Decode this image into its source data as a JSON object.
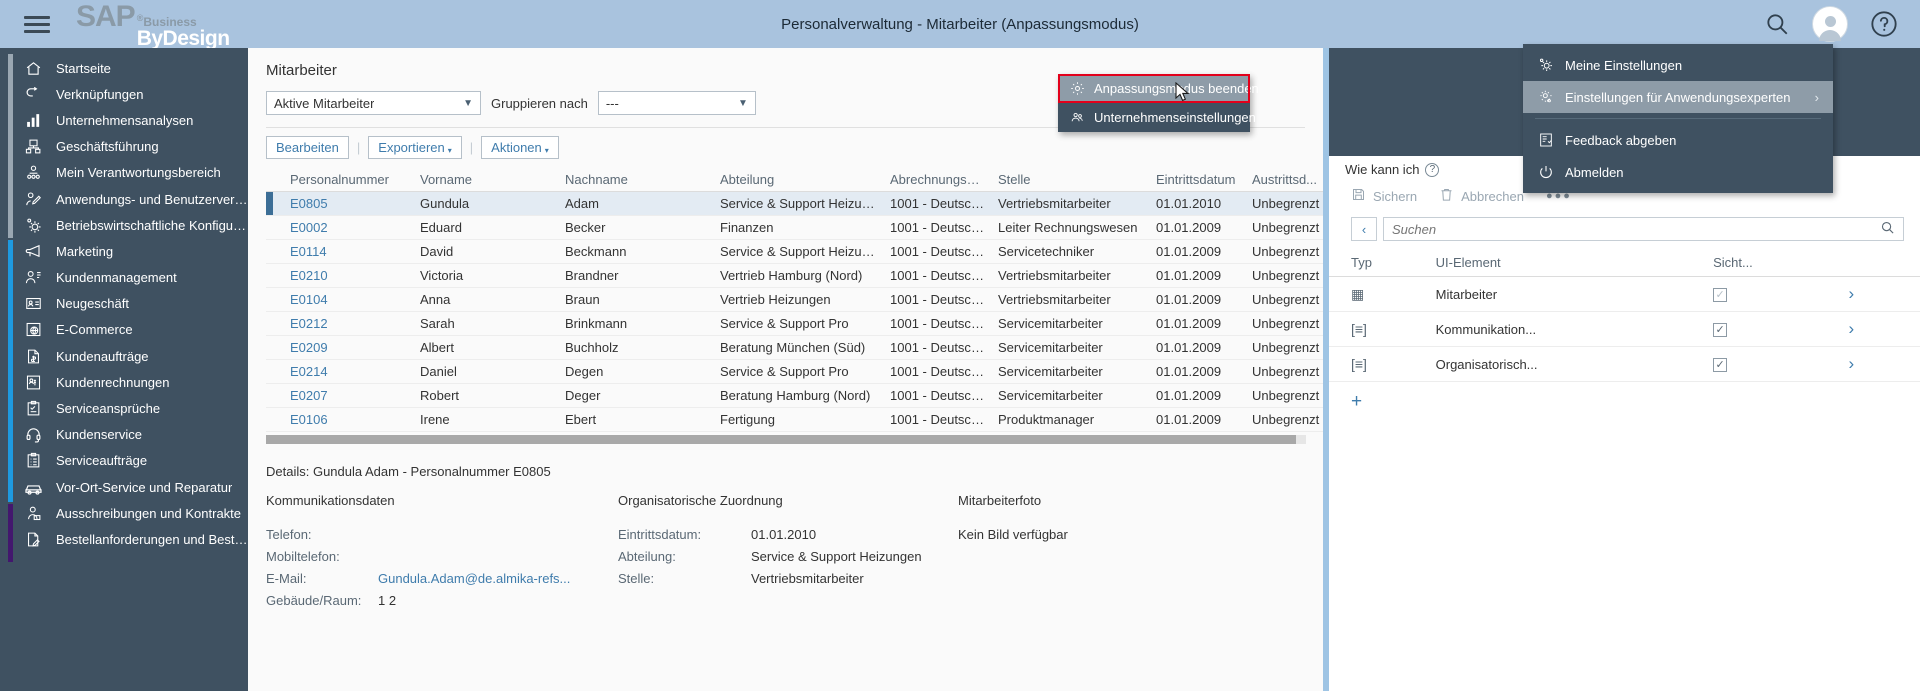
{
  "shell": {
    "brand_sap": "SAP",
    "brand_reg": "®",
    "brand_business": "Business",
    "brand_bydesign": "ByDesign",
    "title": "Personalverwaltung - Mitarbeiter (Anpassungsmodus)",
    "menu_icon": "hamburger-icon",
    "search_icon": "search-icon",
    "help_icon": "help-icon",
    "avatar_icon": "user-avatar-icon"
  },
  "sidebar": {
    "items": [
      {
        "label": "Startseite",
        "icon": "home-icon",
        "rail": "gray"
      },
      {
        "label": "Verknüpfungen",
        "icon": "link-icon",
        "rail": "gray"
      },
      {
        "label": "Unternehmensanalysen",
        "icon": "bar-chart-icon",
        "rail": "gray"
      },
      {
        "label": "Geschäftsführung",
        "icon": "org-chart-icon",
        "rail": "gray"
      },
      {
        "label": "Mein Verantwortungsbereich",
        "icon": "people-icon",
        "rail": "gray"
      },
      {
        "label": "Anwendungs- und Benutzerverw...",
        "icon": "user-edit-icon",
        "rail": "gray"
      },
      {
        "label": "Betriebswirtschaftliche Konfigurat...",
        "icon": "gear-config-icon",
        "rail": "gray"
      },
      {
        "label": "Marketing",
        "icon": "megaphone-icon",
        "rail": "blue"
      },
      {
        "label": "Kundenmanagement",
        "icon": "user-list-icon",
        "rail": "blue"
      },
      {
        "label": "Neugeschäft",
        "icon": "contact-card-icon",
        "rail": "blue"
      },
      {
        "label": "E-Commerce",
        "icon": "globe-shop-icon",
        "rail": "blue"
      },
      {
        "label": "Kundenaufträge",
        "icon": "invoice-dollar-icon",
        "rail": "blue"
      },
      {
        "label": "Kundenrechnungen",
        "icon": "billing-icon",
        "rail": "blue"
      },
      {
        "label": "Serviceansprüche",
        "icon": "clipboard-check-icon",
        "rail": "blue"
      },
      {
        "label": "Kundenservice",
        "icon": "headset-icon",
        "rail": "blue"
      },
      {
        "label": "Serviceaufträge",
        "icon": "clipboard-list-icon",
        "rail": "blue"
      },
      {
        "label": "Vor-Ort-Service und Reparatur",
        "icon": "car-service-icon",
        "rail": "blue"
      },
      {
        "label": "Ausschreibungen und Kontrakte",
        "icon": "person-contract-icon",
        "rail": "purple"
      },
      {
        "label": "Bestellanforderungen und Bestell...",
        "icon": "document-edit-icon",
        "rail": "purple"
      }
    ]
  },
  "main": {
    "page_title": "Mitarbeiter",
    "filter": {
      "view_value": "Aktive Mitarbeiter",
      "group_label": "Gruppieren nach",
      "group_value": "---"
    },
    "toolbar": {
      "edit": "Bearbeiten",
      "export": "Exportieren",
      "actions": "Aktionen"
    },
    "table": {
      "columns": [
        "Personalnummer",
        "Vorname",
        "Nachname",
        "Abteilung",
        "Abrechnungskreis",
        "Stelle",
        "Eintrittsdatum",
        "Austrittsd..."
      ],
      "rows": [
        {
          "pnr": "E0805",
          "vorname": "Gundula",
          "nachname": "Adam",
          "abteilung": "Service & Support Heizungen",
          "abrechnungskreis": "1001 - Deutschla...",
          "stelle": "Vertriebsmitarbeiter",
          "eintritt": "01.01.2010",
          "austritt": "Unbegrenzt",
          "selected": true
        },
        {
          "pnr": "E0002",
          "vorname": "Eduard",
          "nachname": "Becker",
          "abteilung": "Finanzen",
          "abrechnungskreis": "1001 - Deutschla...",
          "stelle": "Leiter Rechnungswesen",
          "eintritt": "01.01.2009",
          "austritt": "Unbegrenzt",
          "selected": false
        },
        {
          "pnr": "E0114",
          "vorname": "David",
          "nachname": "Beckmann",
          "abteilung": "Service & Support Heizungen",
          "abrechnungskreis": "1001 - Deutschla...",
          "stelle": "Servicetechniker",
          "eintritt": "01.01.2009",
          "austritt": "Unbegrenzt",
          "selected": false
        },
        {
          "pnr": "E0210",
          "vorname": "Victoria",
          "nachname": "Brandner",
          "abteilung": "Vertrieb Hamburg (Nord)",
          "abrechnungskreis": "1001 - Deutschla...",
          "stelle": "Vertriebsmitarbeiter",
          "eintritt": "01.01.2009",
          "austritt": "Unbegrenzt",
          "selected": false
        },
        {
          "pnr": "E0104",
          "vorname": "Anna",
          "nachname": "Braun",
          "abteilung": "Vertrieb Heizungen",
          "abrechnungskreis": "1001 - Deutschla...",
          "stelle": "Vertriebsmitarbeiter",
          "eintritt": "01.01.2009",
          "austritt": "Unbegrenzt",
          "selected": false
        },
        {
          "pnr": "E0212",
          "vorname": "Sarah",
          "nachname": "Brinkmann",
          "abteilung": "Service & Support Pro",
          "abrechnungskreis": "1001 - Deutschla...",
          "stelle": "Servicemitarbeiter",
          "eintritt": "01.01.2009",
          "austritt": "Unbegrenzt",
          "selected": false
        },
        {
          "pnr": "E0209",
          "vorname": "Albert",
          "nachname": "Buchholz",
          "abteilung": "Beratung München (Süd)",
          "abrechnungskreis": "1001 - Deutschla...",
          "stelle": "Servicemitarbeiter",
          "eintritt": "01.01.2009",
          "austritt": "Unbegrenzt",
          "selected": false
        },
        {
          "pnr": "E0214",
          "vorname": "Daniel",
          "nachname": "Degen",
          "abteilung": "Service & Support Pro",
          "abrechnungskreis": "1001 - Deutschla...",
          "stelle": "Servicemitarbeiter",
          "eintritt": "01.01.2009",
          "austritt": "Unbegrenzt",
          "selected": false
        },
        {
          "pnr": "E0207",
          "vorname": "Robert",
          "nachname": "Deger",
          "abteilung": "Beratung Hamburg (Nord)",
          "abrechnungskreis": "1001 - Deutschla...",
          "stelle": "Servicemitarbeiter",
          "eintritt": "01.01.2009",
          "austritt": "Unbegrenzt",
          "selected": false
        },
        {
          "pnr": "E0106",
          "vorname": "Irene",
          "nachname": "Ebert",
          "abteilung": "Fertigung",
          "abrechnungskreis": "1001 - Deutschla...",
          "stelle": "Produktmanager",
          "eintritt": "01.01.2009",
          "austritt": "Unbegrenzt",
          "selected": false
        }
      ]
    },
    "details": {
      "title": "Details: Gundula Adam - Personalnummer E0805",
      "group1": {
        "heading": "Kommunikationsdaten",
        "rows": [
          {
            "label": "Telefon:",
            "value": "",
            "link": false
          },
          {
            "label": "Mobiltelefon:",
            "value": "",
            "link": false
          },
          {
            "label": "E-Mail:",
            "value": "Gundula.Adam@de.almika-refs...",
            "link": true
          },
          {
            "label": "Gebäude/Raum:",
            "value": "1 2",
            "link": false
          }
        ]
      },
      "group2": {
        "heading": "Organisatorische Zuordnung",
        "rows": [
          {
            "label": "Eintrittsdatum:",
            "value": "01.01.2010"
          },
          {
            "label": "Abteilung:",
            "value": "Service & Support Heizungen"
          },
          {
            "label": "Stelle:",
            "value": "Vertriebsmitarbeiter"
          }
        ]
      },
      "group3": {
        "heading": "Mitarbeiterfoto",
        "empty_text": "Kein Bild verfügbar"
      }
    }
  },
  "right_panel": {
    "how_to": "Wie kann ich",
    "how_to_icon": "help-circle-icon",
    "save": "Sichern",
    "save_icon": "save-icon",
    "cancel": "Abbrechen",
    "cancel_icon": "trash-icon",
    "more_icon": "more-dots-icon",
    "back_icon": "chevron-left-icon",
    "search_placeholder": "Suchen",
    "search_value": "",
    "search_icon": "search-icon",
    "columns": [
      "Typ",
      "UI-Element",
      "Sicht..."
    ],
    "rows": [
      {
        "type_icon": "table-grid-icon",
        "type_glyph": "▦",
        "element": "Mitarbeiter",
        "visible": true,
        "visible_enabled": false,
        "arrow_icon": "chevron-right-icon"
      },
      {
        "type_icon": "section-icon",
        "type_glyph": "[≡]",
        "element": "Kommunikation...",
        "visible": true,
        "visible_enabled": true,
        "arrow_icon": "chevron-right-icon"
      },
      {
        "type_icon": "section-icon",
        "type_glyph": "[≡]",
        "element": "Organisatorisch...",
        "visible": true,
        "visible_enabled": true,
        "arrow_icon": "chevron-right-icon"
      }
    ],
    "add_label": "+"
  },
  "context_menu": {
    "items": [
      {
        "label": "Anpassungsmodus beenden",
        "icon": "gear-adapt-icon",
        "highlighted": true
      },
      {
        "label": "Unternehmenseinstellungen",
        "icon": "company-settings-icon",
        "highlighted": false
      }
    ]
  },
  "user_menu": {
    "items": [
      {
        "label": "Meine Einstellungen",
        "icon": "gear-icon",
        "highlighted": false,
        "has_submenu": false
      },
      {
        "label": "Einstellungen für Anwendungsexperten",
        "icon": "expert-settings-icon",
        "highlighted": true,
        "has_submenu": true,
        "submenu_icon": "chevron-right-icon"
      },
      {
        "label": "Feedback abgeben",
        "icon": "feedback-icon",
        "highlighted": false,
        "has_submenu": false
      },
      {
        "label": "Abmelden",
        "icon": "power-icon",
        "highlighted": false,
        "has_submenu": false
      }
    ],
    "submenu_arrow": "›"
  },
  "colors": {
    "shell_bg": "#a9c3de",
    "sidenav_bg": "#3f5161",
    "accent_blue": "#1e9ae0",
    "accent_purple": "#43176e",
    "link": "#3f7cac",
    "highlight_red": "#e3001b",
    "row_selected": "#e3ebf3"
  }
}
